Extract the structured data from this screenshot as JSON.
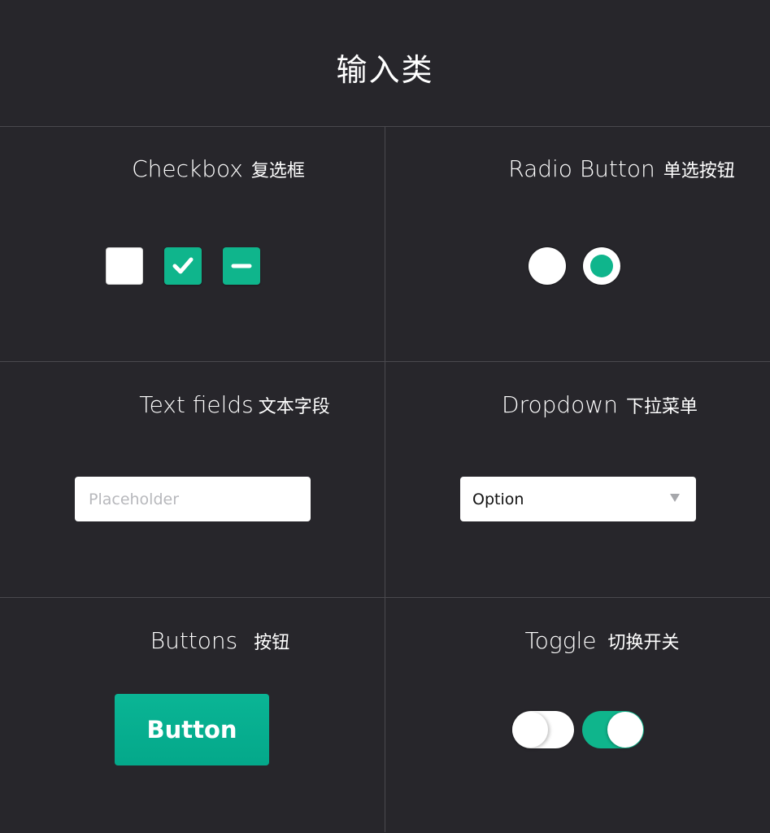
{
  "page": {
    "title": "输入类"
  },
  "theme": {
    "background": "#27262b",
    "accent": "#0fb58c",
    "divider": "#4a494e"
  },
  "sections": {
    "checkbox": {
      "title_en": "Checkbox",
      "title_zh": "复选框",
      "states": [
        "unchecked",
        "checked",
        "indeterminate"
      ]
    },
    "radio": {
      "title_en": "Radio Button",
      "title_zh": "单选按钮",
      "states": [
        "unselected",
        "selected"
      ]
    },
    "text_fields": {
      "title_en": "Text fields",
      "title_zh": "文本字段",
      "value": "",
      "placeholder": "Placeholder"
    },
    "dropdown": {
      "title_en": "Dropdown",
      "title_zh": "下拉菜单",
      "selected": "Option",
      "icon": "caret-down-icon"
    },
    "buttons": {
      "title_en": "Buttons",
      "title_zh": "按钮",
      "label": "Button"
    },
    "toggle": {
      "title_en": "Toggle",
      "title_zh": "切换开关",
      "states": [
        "off",
        "on"
      ]
    }
  }
}
